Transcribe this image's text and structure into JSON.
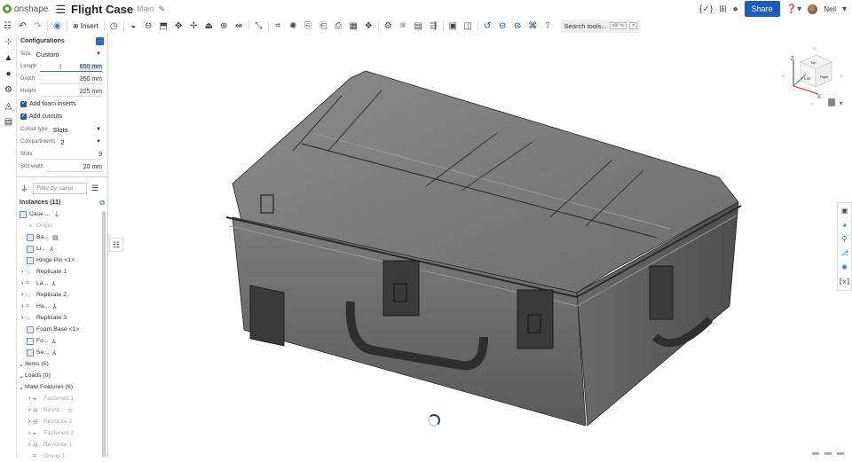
{
  "app": {
    "name": "onshape"
  },
  "header": {
    "title": "Flight Case",
    "branch": "Main",
    "share_label": "Share",
    "user_name": "Neil"
  },
  "toolbar": {
    "insert_label": "Insert",
    "search_label": "Search tools...",
    "search_shortcut_1": "alt/⌥",
    "search_shortcut_2": "c"
  },
  "configurations": {
    "title": "Configurations",
    "size": {
      "label": "Size",
      "value": "Custom"
    },
    "length": {
      "label": "Length",
      "value": "650 mm"
    },
    "depth": {
      "label": "Depth",
      "value": "350 mm"
    },
    "height": {
      "label": "Height",
      "value": "225 mm"
    },
    "add_foam": {
      "label": "Add foam inserts",
      "checked": true
    },
    "add_cutouts": {
      "label": "Add cutouts",
      "checked": true
    },
    "cutout_type": {
      "label": "Cutout type",
      "value": "Slots"
    },
    "compartments": {
      "label": "Compartments",
      "value": "2"
    },
    "slots": {
      "label": "Slots",
      "value": "9"
    },
    "slot_width": {
      "label": "Slot width",
      "value": "20 mm"
    }
  },
  "filter": {
    "placeholder": "Filter by name"
  },
  "instances": {
    "title": "Instances (11)",
    "items": [
      {
        "label": "Case ...",
        "grey": false
      },
      {
        "label": "Origin",
        "grey": true
      },
      {
        "label": "Ba...",
        "grey": false
      },
      {
        "label": "Li...",
        "grey": false
      },
      {
        "label": "Hinge Pin <1>",
        "grey": false
      },
      {
        "label": "Replicate 1",
        "grey": false
      },
      {
        "label": "La...",
        "grey": false
      },
      {
        "label": "Replicate 2",
        "grey": false
      },
      {
        "label": "Ha...",
        "grey": false
      },
      {
        "label": "Replicate 3",
        "grey": false
      },
      {
        "label": "Foam Base <1>",
        "grey": false
      },
      {
        "label": "Fo...",
        "grey": false
      },
      {
        "label": "Se...",
        "grey": false
      }
    ]
  },
  "groups": {
    "items": "Items (0)",
    "loads": "Loads (0)",
    "mate_features": "Mate Features (6)"
  },
  "mates": [
    {
      "label": "Fastened 1"
    },
    {
      "label": "Revol..."
    },
    {
      "label": "Revolute 2"
    },
    {
      "label": "Fastened 2"
    },
    {
      "label": "Revolute 1"
    },
    {
      "label": "Group 1"
    }
  ],
  "viewcube": {
    "top": "Top",
    "front": "Front",
    "right": "Right",
    "x": "X",
    "y": "Y",
    "z": "Z"
  },
  "colors": {
    "accent": "#1d5bbf",
    "logo": "#5aa02c"
  }
}
